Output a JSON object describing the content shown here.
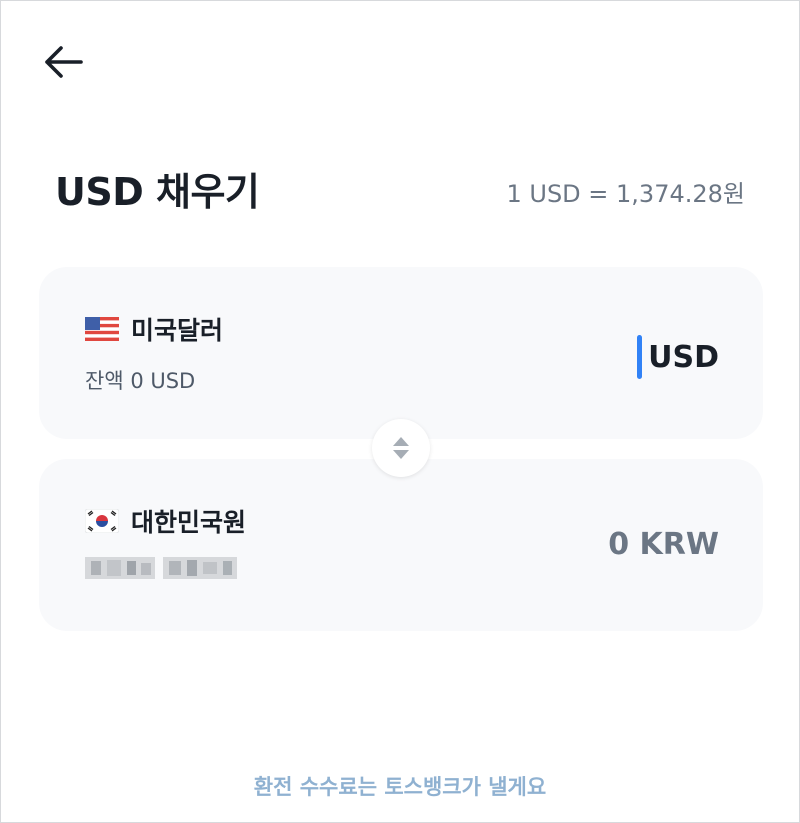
{
  "header": {
    "back_icon": "arrow-left-icon"
  },
  "page": {
    "title": "USD 채우기",
    "exchange_rate": "1 USD = 1,374.28원"
  },
  "from_currency": {
    "flag_icon": "us-flag-icon",
    "name": "미국달러",
    "balance": "잔액 0 USD",
    "amount_unit": "USD",
    "caret_color": "#3182f6"
  },
  "swap": {
    "icon": "swap-updown-icon"
  },
  "to_currency": {
    "flag_icon": "kr-flag-icon",
    "name": "대한민국원",
    "amount": "0 KRW"
  },
  "footer": {
    "notice": "환전 수수료는 토스뱅크가 낼게요"
  }
}
